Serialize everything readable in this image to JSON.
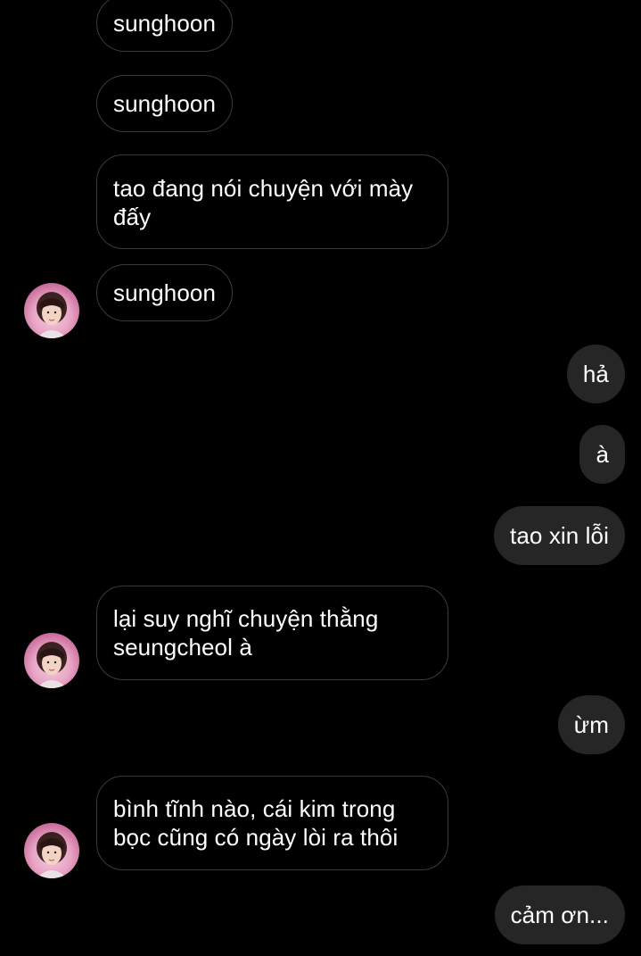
{
  "messages": [
    {
      "sender": "them",
      "text": "sunghoon"
    },
    {
      "sender": "them",
      "text": "sunghoon"
    },
    {
      "sender": "them",
      "text": "tao đang nói chuyện với mày đấy"
    },
    {
      "sender": "them",
      "text": "sunghoon"
    },
    {
      "sender": "me",
      "text": "hả"
    },
    {
      "sender": "me",
      "text": "à"
    },
    {
      "sender": "me",
      "text": "tao xin lỗi"
    },
    {
      "sender": "them",
      "text": "lại suy nghĩ chuyện thằng seungcheol à"
    },
    {
      "sender": "me",
      "text": "ừm"
    },
    {
      "sender": "them",
      "text": "bình tĩnh nào, cái kim trong bọc cũng có ngày lòi ra thôi"
    },
    {
      "sender": "me",
      "text": "cảm ơn..."
    }
  ],
  "colors": {
    "background": "#000000",
    "incoming_border": "#3a3a3a",
    "outgoing_bubble": "#262626",
    "text": "#ffffff"
  },
  "icons": {
    "avatar": "contact-avatar"
  }
}
